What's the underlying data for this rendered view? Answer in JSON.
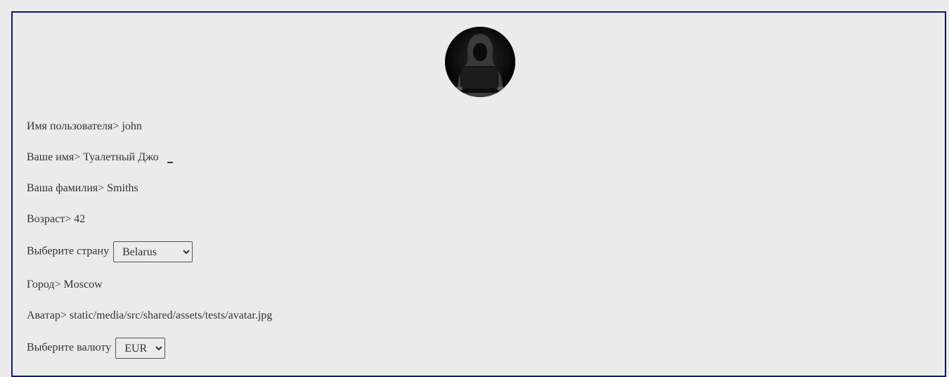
{
  "profile": {
    "avatar_icon": "hooded-hacker-avatar",
    "username": {
      "label": "Имя пользователя>",
      "value": "john"
    },
    "first_name": {
      "label": "Ваше имя>",
      "value": "Туалетный Джо"
    },
    "last_name": {
      "label": "Ваша фамилия>",
      "value": "Smiths"
    },
    "age": {
      "label": "Возраст>",
      "value": "42"
    },
    "country": {
      "label": "Выберите страну",
      "selected": "Belarus"
    },
    "city": {
      "label": "Город>",
      "value": "Moscow"
    },
    "avatar": {
      "label": "Аватар>",
      "value": "static/media/src/shared/assets/tests/avatar.jpg"
    },
    "currency": {
      "label": "Выберите валюту",
      "selected": "EUR"
    }
  },
  "colors": {
    "background": "#ebebeb",
    "border": "#0d1b6e",
    "text": "#333333"
  }
}
